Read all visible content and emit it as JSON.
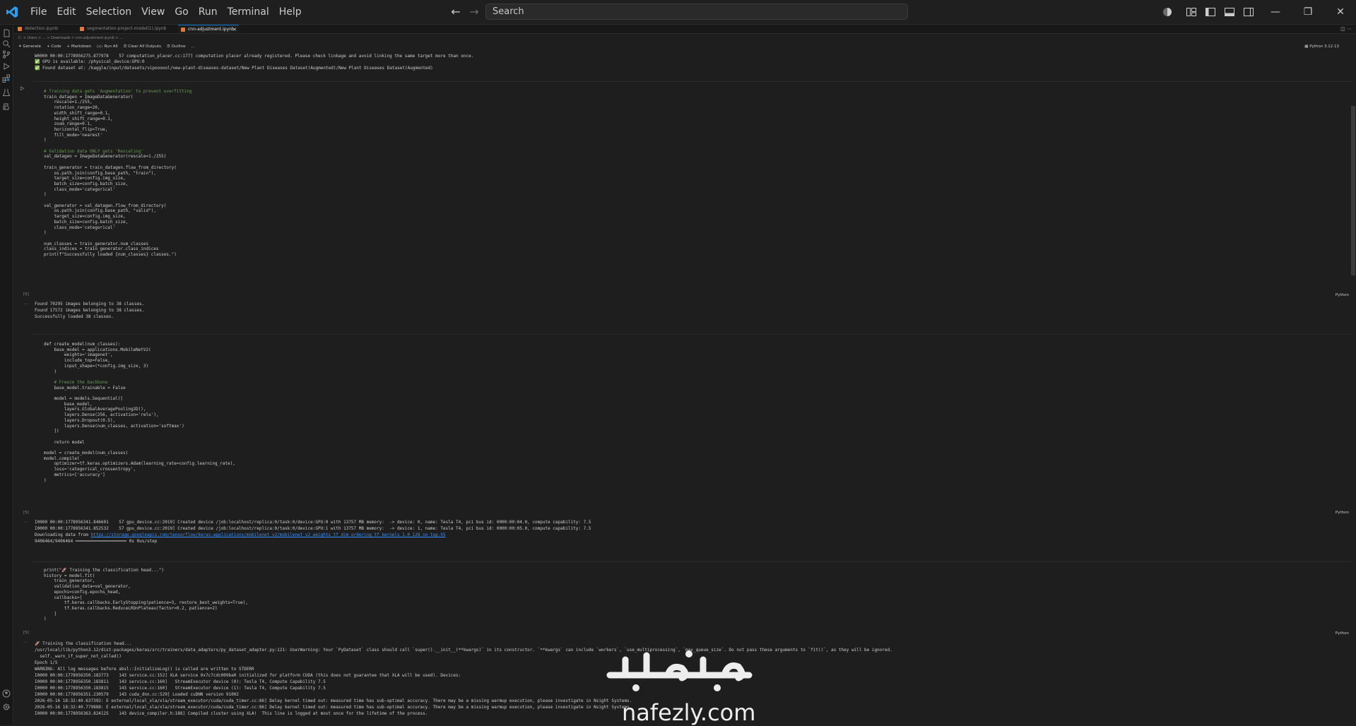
{
  "menu": [
    "File",
    "Edit",
    "Selection",
    "View",
    "Go",
    "Run",
    "Terminal",
    "Help"
  ],
  "search": {
    "text": "Search"
  },
  "tabs": [
    {
      "label": "detection.ipynb"
    },
    {
      "label": "segmentation-project-model(1).ipynb"
    },
    {
      "label": "cnn-adjustment.ipynb"
    }
  ],
  "breadcrumb": "C: > Users > ... > Downloads > cnn-adjustment.ipynb > ...",
  "toolbar": {
    "generate": "Generate",
    "code": "Code",
    "markdown": "Markdown",
    "run_all": "Run All",
    "clear_outputs": "Clear All Outputs",
    "outline": "Outline",
    "more": "..."
  },
  "kernel": "Python 3.12.13",
  "lang": "Python",
  "exec_count": "[5]",
  "cell1_output_top": [
    "W0000 00:00:1778956275.877978    57 computation_placer.cc:177] computation placer already registered. Please check linkage and avoid linking the same target more than once.",
    "✅ GPU is available: /physical_device:GPU:0",
    "✅ Found dataset at: /kaggle/input/datasets/vipoooool/new-plant-diseases-dataset/New Plant Diseases Dataset(Augmented)/New Plant Diseases Dataset(Augmented)"
  ],
  "cell2_code": [
    "# Training data gets 'Augmentation' to prevent overfitting",
    "train_datagen = ImageDataGenerator(",
    "    rescale=1./255,",
    "    rotation_range=20,",
    "    width_shift_range=0.1,",
    "    height_shift_range=0.1,",
    "    zoom_range=0.1,",
    "    horizontal_flip=True,",
    "    fill_mode='nearest'",
    ")",
    "",
    "# Validation data ONLY gets 'Rescaling'",
    "val_datagen = ImageDataGenerator(rescale=1./255)",
    "",
    "train_generator = train_datagen.flow_from_directory(",
    "    os.path.join(config.base_path, \"train\"),",
    "    target_size=config.img_size,",
    "    batch_size=config.batch_size,",
    "    class_mode='categorical'",
    ")",
    "",
    "val_generator = val_datagen.flow_from_directory(",
    "    os.path.join(config.base_path, \"valid\"),",
    "    target_size=config.img_size,",
    "    batch_size=config.batch_size,",
    "    class_mode='categorical'",
    ")",
    "",
    "num_classes = train_generator.num_classes",
    "class_indices = train_generator.class_indices",
    "print(f\"Successfully loaded {num_classes} classes.\")"
  ],
  "cell2_output": [
    "Found 70295 images belonging to 38 classes.",
    "Found 17572 images belonging to 38 classes.",
    "Successfully loaded 38 classes."
  ],
  "cell3_code": [
    "def create_model(num_classes):",
    "    base_model = applications.MobileNetV2(",
    "        weights='imagenet',",
    "        include_top=False,",
    "        input_shape=(*config.img_size, 3)",
    "    )",
    "",
    "    # Freeze the backbone",
    "    base_model.trainable = False",
    "",
    "    model = models.Sequential([",
    "        base_model,",
    "        layers.GlobalAveragePooling2D(),",
    "        layers.Dense(256, activation='relu'),",
    "        layers.Dropout(0.5),",
    "        layers.Dense(num_classes, activation='softmax')",
    "    ])",
    "",
    "    return model",
    "",
    "model = create_model(num_classes)",
    "model.compile(",
    "    optimizer=tf.keras.optimizers.Adam(learning_rate=config.learning_rate),",
    "    loss='categorical_crossentropy',",
    "    metrics=['accuracy']",
    ")"
  ],
  "cell3_output": [
    "I0000 00:00:1778956341.846601    57 gpu_device.cc:2019] Created device /job:localhost/replica:0/task:0/device:GPU:0 with 13757 MB memory:  -> device: 0, name: Tesla T4, pci bus id: 0000:00:04.0, compute capability: 7.5",
    "I0000 00:00:1778956341.852532    57 gpu_device.cc:2019] Created device /job:localhost/replica:0/task:0/device:GPU:1 with 13757 MB memory:  -> device: 1, name: Tesla T4, pci bus id: 0000:00:05.0, compute capability: 7.5",
    "Downloading data from ",
    "9406464/9406464 ━━━━━━━━━━━━━━━━━━━━ 0s 0us/step"
  ],
  "cell3_link": "https://storage.googleapis.com/tensorflow/keras-applications/mobilenet_v2/mobilenet_v2_weights_tf_dim_ordering_tf_kernels_1.0_128_no_top.h5",
  "cell4_code": [
    "print(\"🚀 Training the classification head...\")",
    "history = model.fit(",
    "    train_generator,",
    "    validation_data=val_generator,",
    "    epochs=config.epochs_head,",
    "    callbacks=[",
    "        tf.keras.callbacks.EarlyStopping(patience=3, restore_best_weights=True),",
    "        tf.keras.callbacks.ReduceLROnPlateau(factor=0.2, patience=2)",
    "    ]",
    ")"
  ],
  "cell4_output": [
    "🚀 Training the classification head...",
    "/usr/local/lib/python3.12/dist-packages/keras/src/trainers/data_adapters/py_dataset_adapter.py:121: UserWarning: Your `PyDataset` class should call `super().__init__(**kwargs)` in its constructor. `**kwargs` can include `workers`, `use_multiprocessing`, `max_queue_size`. Do not pass these arguments to `fit()`, as they will be ignored.",
    "  self._warn_if_super_not_called()",
    "Epoch 1/5",
    "WARNING: All log messages before absl::InitializeLog() is called are written to STDERR",
    "I0000 00:00:1778956350.183773    143 service.cc:152] XLA service 0x7c7cdc009ba0 initialized for platform CUDA (this does not guarantee that XLA will be used). Devices:",
    "I0000 00:00:1778956350.183811    143 service.cc:160]   StreamExecutor device (0): Tesla T4, Compute Capability 7.5",
    "I0000 00:00:1778956350.183815    143 service.cc:160]   StreamExecutor device (1): Tesla T4, Compute Capability 7.5",
    "I0000 00:00:1778956351.230579    143 cuda_dnn.cc:529] Loaded cuDNN version 91002",
    "2026-05-16 18:32:40.637392: E external/local_xla/xla/stream_executor/cuda/cuda_timer.cc:86] Delay kernel timed out: measured time has sub-optimal accuracy. There may be a missing warmup execution, please investigate in Nsight Systems.",
    "2026-05-16 18:32:40.779888: E external/local_xla/xla/stream_executor/cuda/cuda_timer.cc:86] Delay kernel timed out: measured time has sub-optimal accuracy. There may be a missing warmup execution, please investigate in Nsight Systems.",
    "I0000 00:00:1778956363.824125    143 device_compiler.h:188] Compiled cluster using XLA!  This line is logged at most once for the lifetime of the process."
  ],
  "watermark": {
    "arabic": "نفذلي",
    "latin": "nafezly.com"
  }
}
